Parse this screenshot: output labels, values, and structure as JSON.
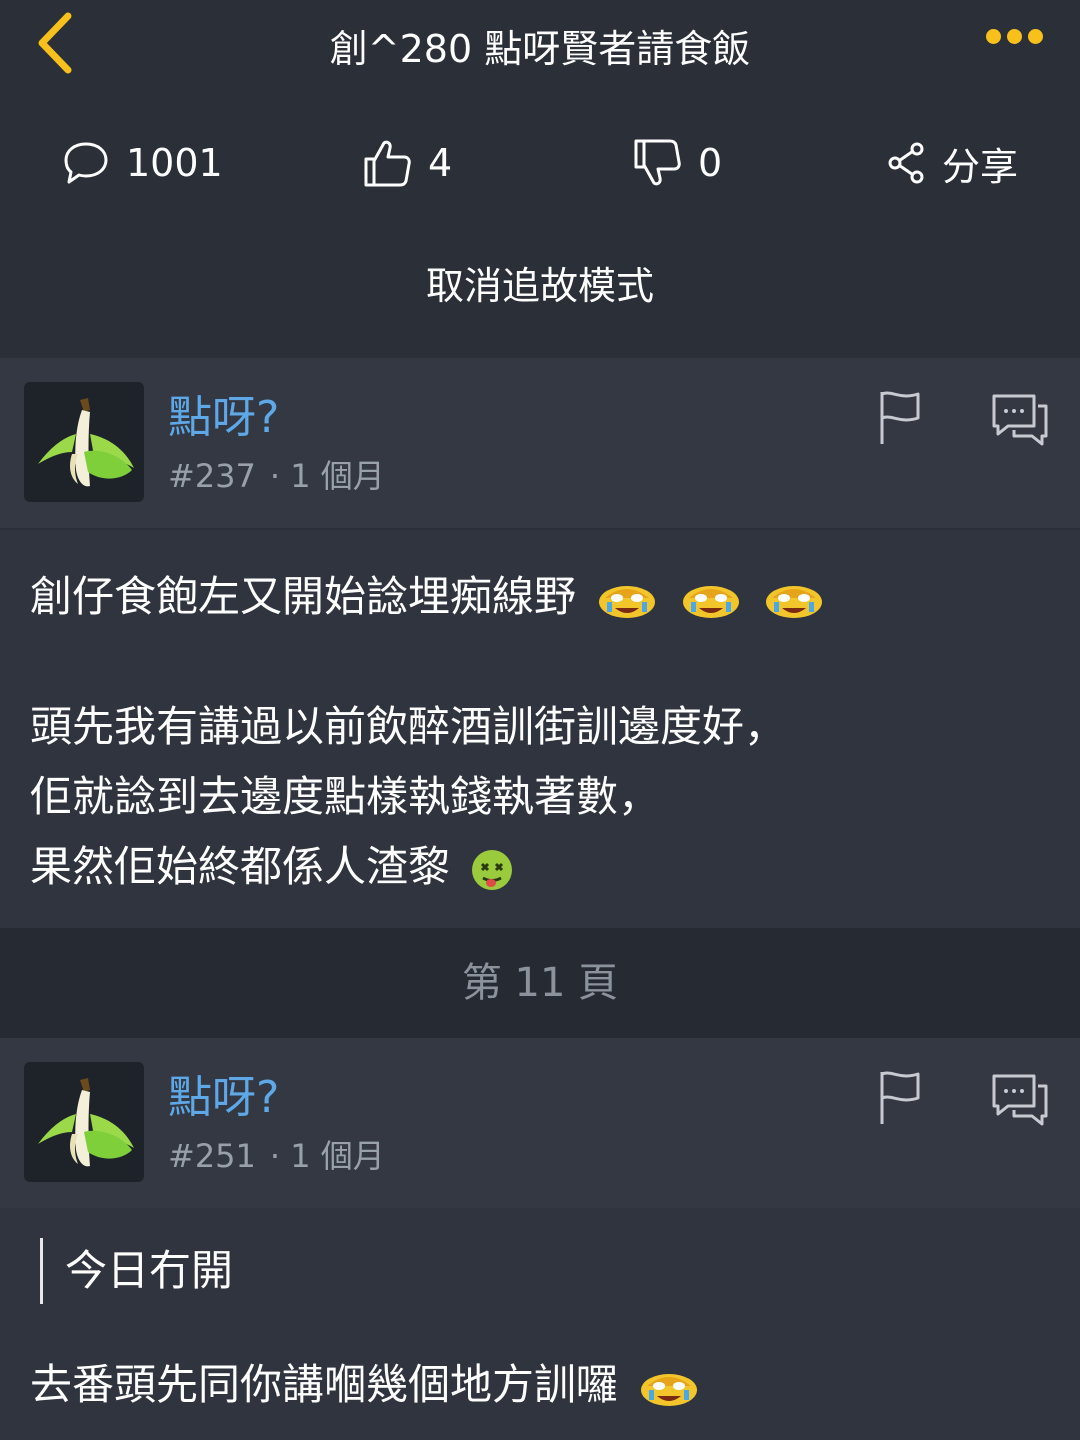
{
  "header": {
    "title": "創^280 點呀賢者請食飯",
    "back_icon": "chevron-left-icon",
    "more_icon": "more-dots-icon",
    "accent_color": "#f7c01b"
  },
  "stats": {
    "comments": "1001",
    "likes": "4",
    "dislikes": "0",
    "share_label": "分享"
  },
  "follow_mode_label": "取消追故模式",
  "posts": [
    {
      "username": "點呀?",
      "number": "#237",
      "time": "1 個月",
      "lines": [
        "創仔食飽左又開始諗埋痴線野",
        "頭先我有講過以前飲醉酒訓街訓邊度好，",
        "佢就諗到去邊度點樣執錢執著數，",
        "果然佢始終都係人渣黎"
      ]
    },
    {
      "username": "點呀?",
      "number": "#251",
      "time": "1 個月",
      "quote": "今日冇開",
      "lines": [
        "去番頭先同你講嗰幾個地方訓囉"
      ]
    }
  ],
  "page_separator": "第 11 頁",
  "colors": {
    "username": "#5fa8e8",
    "background": "#2a2f38",
    "post_header": "#333843",
    "post_body": "#2f343e"
  }
}
